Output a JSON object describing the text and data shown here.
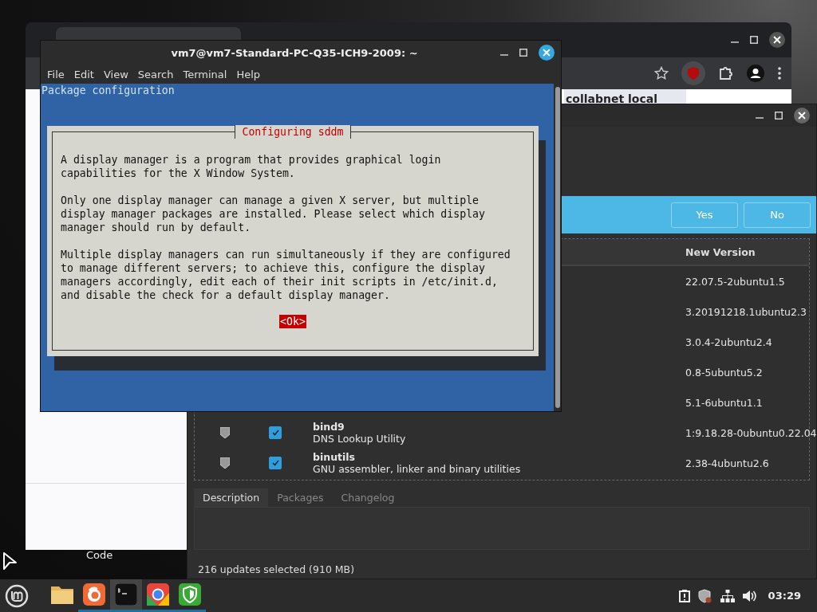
{
  "desktop": {
    "icon_label": "Code"
  },
  "browser": {
    "tabs": [
      {
        "selected": true
      }
    ],
    "page_link": "collabnet local"
  },
  "update_manager": {
    "infobar_buttons": [
      "Yes",
      "No"
    ],
    "columns": [
      "New Version"
    ],
    "rows": [
      {
        "version": "22.07.5-2ubuntu1.5"
      },
      {
        "version": "3.20191218.1ubuntu2.3"
      },
      {
        "version": "3.0.4-2ubuntu2.4"
      },
      {
        "version": "0.8-5ubuntu5.2"
      },
      {
        "version": "5.1-6ubuntu1.1"
      },
      {
        "name": "bind9",
        "description": "DNS Lookup Utility",
        "version": "1:9.18.28-0ubuntu0.22.04",
        "checked": true
      },
      {
        "name": "binutils",
        "description": "GNU assembler, linker and binary utilities",
        "version": "2.38-4ubuntu2.6",
        "checked": true
      }
    ],
    "tabs": [
      {
        "label": "Description",
        "selected": true
      },
      {
        "label": "Packages",
        "selected": false
      },
      {
        "label": "Changelog",
        "selected": false
      }
    ],
    "status": "216 updates selected (910 MB)"
  },
  "terminal": {
    "title": "vm7@vm7-Standard-PC-Q35-ICH9-2009: ~",
    "menu": [
      "File",
      "Edit",
      "View",
      "Search",
      "Terminal",
      "Help"
    ],
    "header": "Package configuration",
    "dialog": {
      "title": "Configuring sddm",
      "paragraphs": [
        "A display manager is a program that provides graphical login\ncapabilities for the X Window System.",
        "Only one display manager can manage a given X server, but multiple\ndisplay manager packages are installed. Please select which display\nmanager should run by default.",
        "Multiple display managers can run simultaneously if they are configured\nto manage different servers; to achieve this, configure the display\nmanagers accordingly, edit each of their init scripts in /etc/init.d,\nand disable the check for a default display manager."
      ],
      "button": "<Ok>"
    }
  },
  "taskbar": {
    "launchers": [
      {
        "kind": "folder",
        "active": false,
        "running": false
      },
      {
        "kind": "firefox",
        "active": false,
        "running": true
      },
      {
        "kind": "terminal",
        "active": true,
        "running": true
      },
      {
        "kind": "chrome",
        "active": false,
        "running": true
      },
      {
        "kind": "shield",
        "active": false,
        "running": true
      }
    ],
    "clock": "03:29"
  }
}
